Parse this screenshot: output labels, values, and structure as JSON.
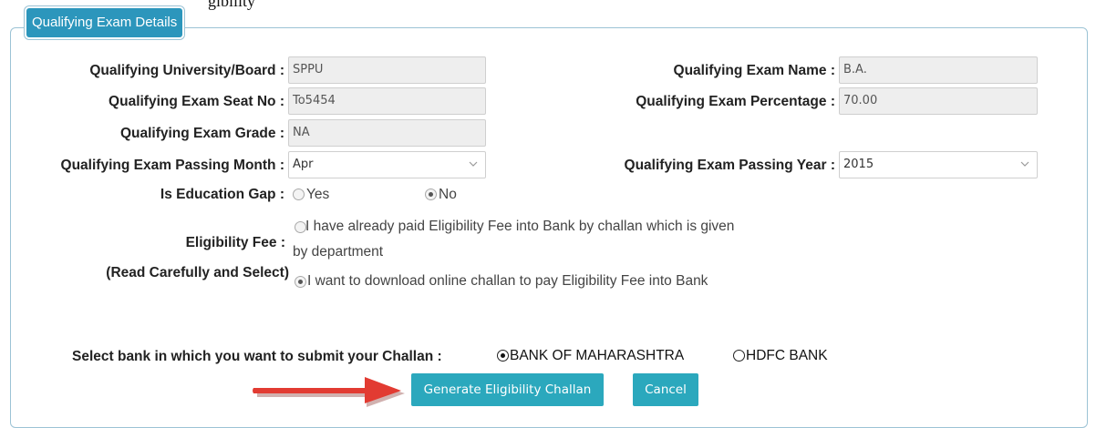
{
  "header_fragment": "gibility",
  "section": {
    "legend": "Qualifying Exam Details"
  },
  "fields": {
    "university": {
      "label": "Qualifying University/Board",
      "value": "SPPU"
    },
    "exam_name": {
      "label": "Qualifying Exam Name",
      "value": "B.A."
    },
    "seat_no": {
      "label": "Qualifying Exam Seat No",
      "value": "To5454"
    },
    "percentage": {
      "label": "Qualifying Exam Percentage",
      "value": "70.00"
    },
    "grade": {
      "label": "Qualifying Exam Grade",
      "value": "NA"
    },
    "passing_month": {
      "label": "Qualifying Exam Passing Month",
      "value": "Apr"
    },
    "passing_year": {
      "label": "Qualifying Exam Passing Year",
      "value": "2015"
    }
  },
  "colon": ":",
  "education_gap": {
    "label": "Is Education Gap",
    "options": [
      {
        "label": "Yes",
        "selected": false
      },
      {
        "label": "No",
        "selected": true
      }
    ]
  },
  "eligibility_fee": {
    "label_line1": "Eligibility Fee",
    "label_line2": "(Read Carefully and Select)",
    "option1_line1": "I have already paid Eligibility Fee into Bank by challan which is given",
    "option1_line2": "by department",
    "option1_selected": false,
    "option2": "I want to download online challan to pay Eligibility Fee into Bank",
    "option2_selected": true
  },
  "bank": {
    "label": "Select bank in which you want to submit your Challan",
    "options": [
      {
        "label": "BANK OF MAHARASHTRA",
        "selected": true
      },
      {
        "label": "HDFC BANK",
        "selected": false
      }
    ]
  },
  "buttons": {
    "generate": "Generate Eligibility Challan",
    "cancel": "Cancel"
  },
  "colors": {
    "legend_bg": "#2c96bc",
    "button_bg": "#2ba8bd",
    "arrow": "#e23b32",
    "border": "#9cc3d5"
  }
}
